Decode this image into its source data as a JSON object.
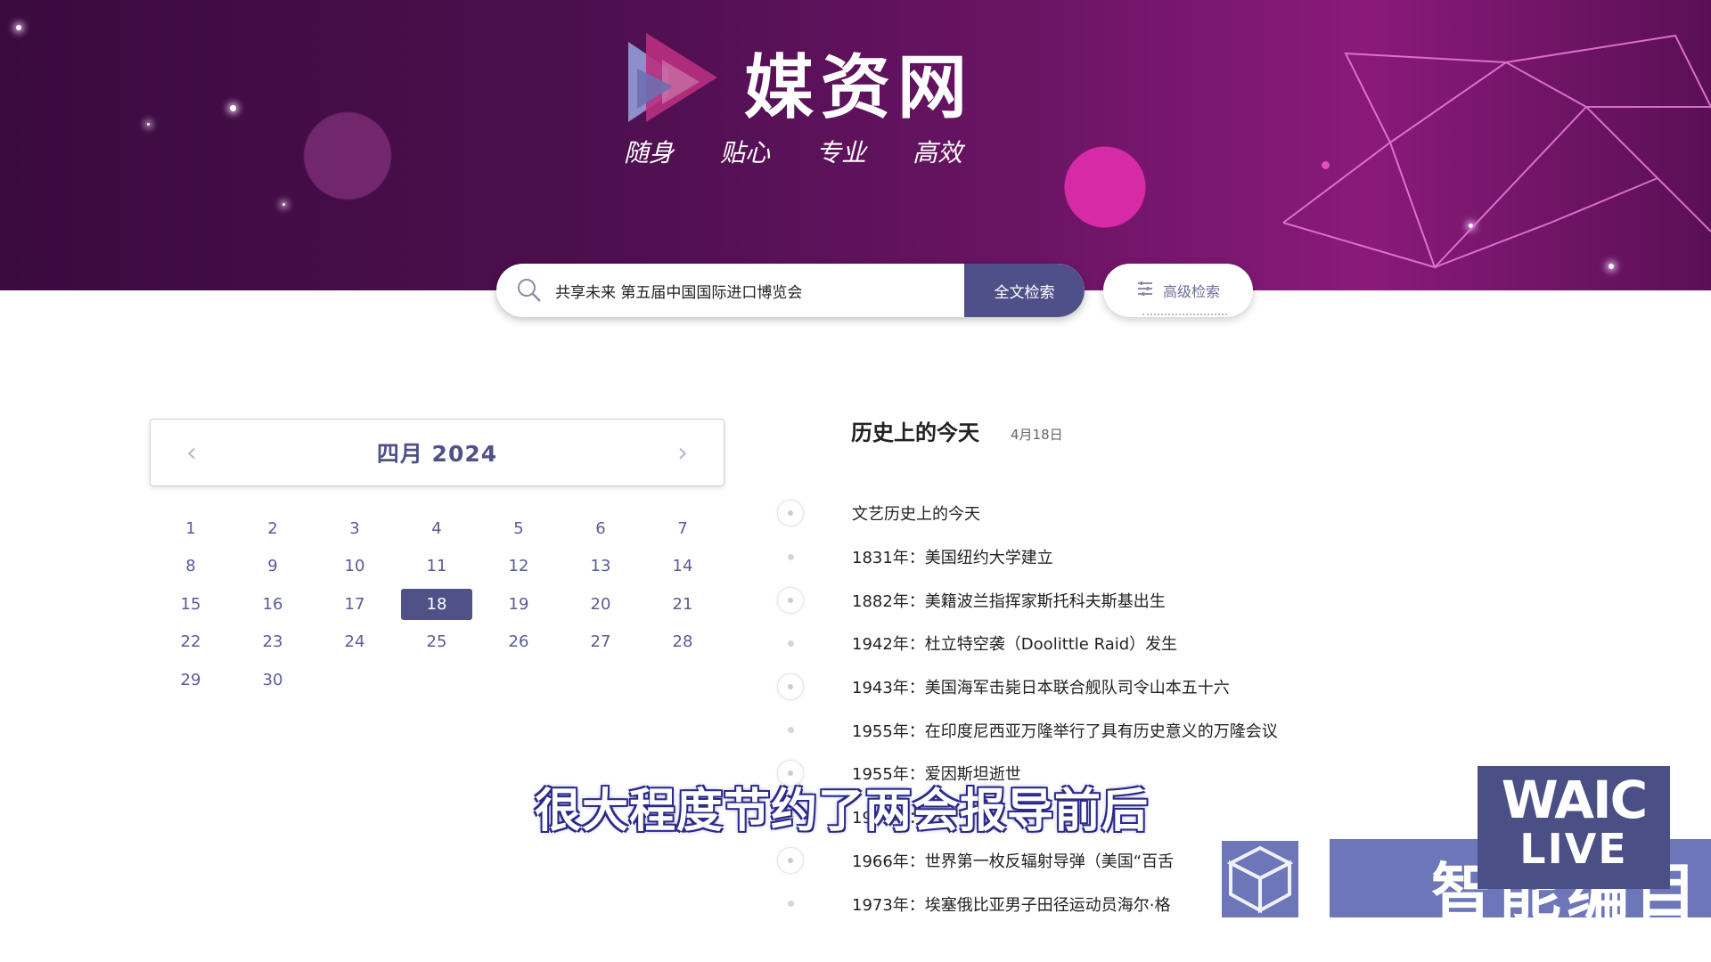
{
  "brand": {
    "title": "媒资网",
    "taglines": [
      "随身",
      "贴心",
      "专业",
      "高效"
    ]
  },
  "search": {
    "query": "共享未来 第五届中国国际进口博览会",
    "fulltext_button": "全文检索",
    "advanced_button": "高级检索"
  },
  "calendar": {
    "month_label": "四月 2024",
    "selected_day": "18",
    "days": [
      "1",
      "2",
      "3",
      "4",
      "5",
      "6",
      "7",
      "8",
      "9",
      "10",
      "11",
      "12",
      "13",
      "14",
      "15",
      "16",
      "17",
      "18",
      "19",
      "20",
      "21",
      "22",
      "23",
      "24",
      "25",
      "26",
      "27",
      "28",
      "29",
      "30"
    ]
  },
  "history": {
    "title": "历史上的今天",
    "date": "4月18日",
    "items": [
      "文艺历史上的今天",
      "1831年：美国纽约大学建立",
      "1882年：美籍波兰指挥家斯托科夫斯基出生",
      "1942年：杜立特空袭（Doolittle Raid）发生",
      "1943年：美国海军击毙日本联合舰队司令山本五十六",
      "1955年：在印度尼西亚万隆举行了具有历史意义的万隆会议",
      "1955年：爱因斯坦逝世",
      "1966年：",
      "1966年：世界第一枚反辐射导弹（美国“百舌",
      "1973年：埃塞俄比亚男子田径运动员海尔·格"
    ]
  },
  "overlay": {
    "subtitle": "很大程度节约了两会报导前后",
    "waic_line1": "WAIC",
    "waic_line2": "LIVE",
    "waic_channel": "智能编目"
  },
  "colors": {
    "accent": "#4f5187",
    "banner_dark": "#3a0a3e",
    "banner_magenta": "#d62aa6"
  }
}
